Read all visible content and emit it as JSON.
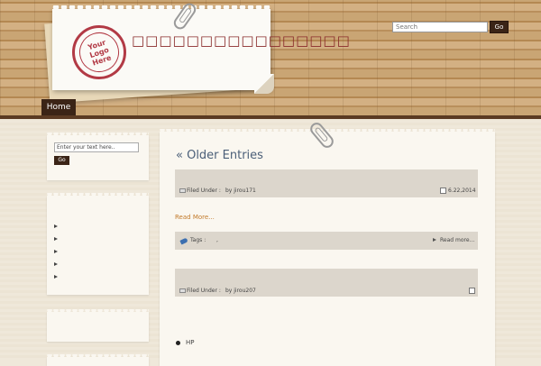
{
  "header": {
    "logo_lines": [
      "Your",
      "Logo",
      "Here"
    ],
    "site_title": "□□□□□□□□□□□□□□□□",
    "search_placeholder": "Search",
    "search_button": "Go"
  },
  "nav": {
    "home_label": "Home"
  },
  "sidebar": {
    "search_input_value": "Enter your text here..",
    "search_button": "Go",
    "list_bullets": 5
  },
  "main": {
    "older_entries": "« Older Entries",
    "post1": {
      "filed_under": "Filed Under :",
      "author": "by jirou171",
      "date": "6.22,2014",
      "read_more": "Read More...",
      "tags_label": "Tags :",
      "tags_value": ",",
      "read_more_right": "Read more..."
    },
    "post2": {
      "filed_under": "Filed Under :",
      "author": "by jirou207"
    },
    "bottom_item": "HP"
  },
  "colors": {
    "dark_brown": "#3b2416",
    "title_red": "#8a2b2b",
    "link_blue": "#4b5f78",
    "read_more_orange": "#c27a2a",
    "meta_bar": "#dcd6cc"
  }
}
